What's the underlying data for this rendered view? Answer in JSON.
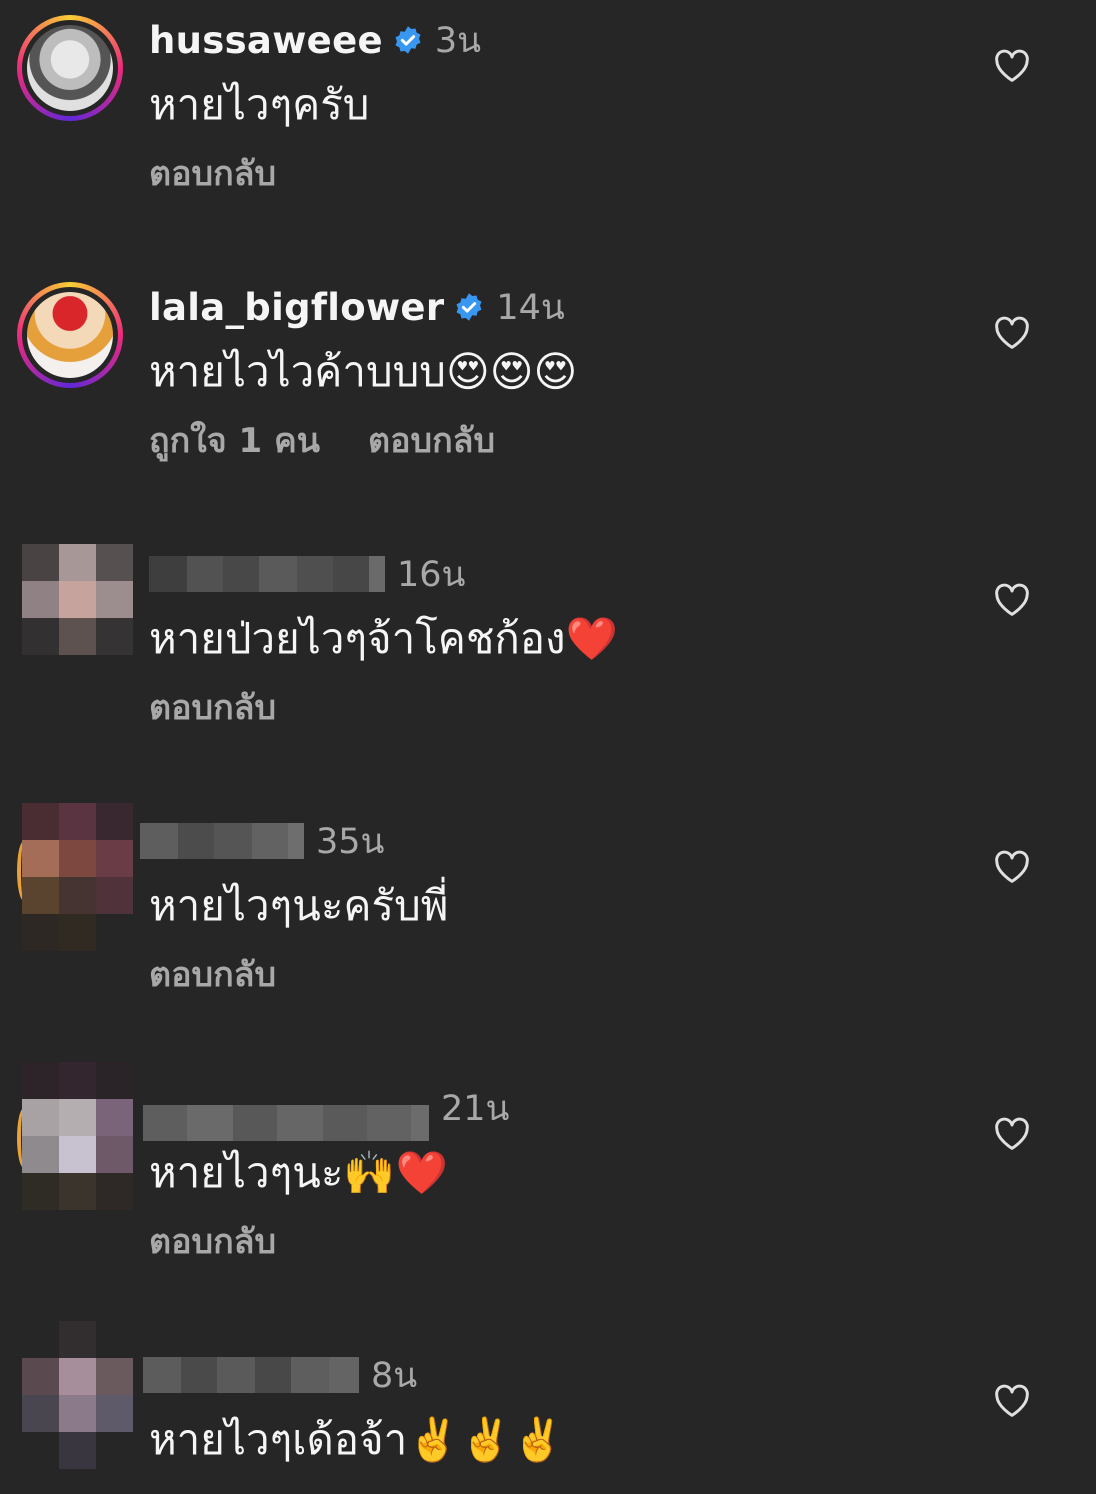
{
  "comments": [
    {
      "username": "hussaweee",
      "verified": true,
      "time": "3น",
      "text": "หายไวๆครับ",
      "likes": "",
      "reply": "ตอบกลับ",
      "avatar": "photo-man"
    },
    {
      "username": "lala_bigflower",
      "verified": true,
      "time": "14น",
      "text": "หายไวไวค้าบบบ😍😍😍",
      "likes": "ถูกใจ 1 คน",
      "reply": "ตอบกลับ",
      "avatar": "photo-lala"
    },
    {
      "username": "",
      "verified": false,
      "time": "16น",
      "text": "หายป่วยไวๆจ้าโคชก้อง❤️",
      "likes": "",
      "reply": "ตอบกลับ",
      "avatar": "pixelated"
    },
    {
      "username": "",
      "verified": false,
      "time": "35น",
      "text": "หายไวๆนะครับพี่",
      "likes": "",
      "reply": "ตอบกลับ",
      "avatar": "pixelated"
    },
    {
      "username": "",
      "verified": false,
      "time": "21น",
      "text": "หายไวๆนะ🙌❤️",
      "likes": "",
      "reply": "ตอบกลับ",
      "avatar": "pixelated"
    },
    {
      "username": "",
      "verified": false,
      "time": "8น",
      "text": "หายไวๆเด้อจ้า✌️✌️✌️",
      "likes": "",
      "reply": "",
      "avatar": "pixelated"
    }
  ],
  "icons": {
    "like": "heart-outline-icon",
    "verified": "verified-badge-icon"
  },
  "colors": {
    "background": "#262626",
    "primary_text": "#f5f5f5",
    "secondary_text": "#a8a8a8",
    "verified_badge": "#3897f0"
  }
}
